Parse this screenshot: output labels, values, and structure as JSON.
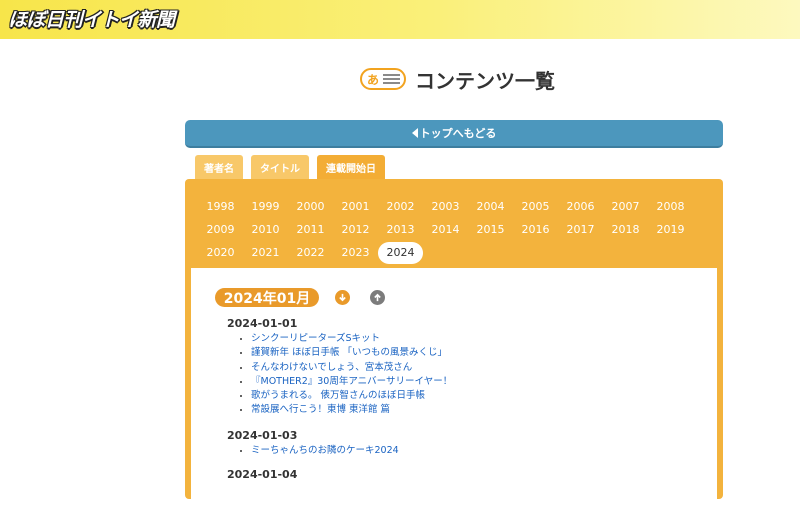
{
  "site": {
    "logo": "ほぼ日刊イトイ新聞"
  },
  "page": {
    "title_icon_letter": "あ",
    "title": "コンテンツ一覧"
  },
  "nav": {
    "back_label": "トップへもどる"
  },
  "tabs": [
    {
      "label": "著者名",
      "active": false
    },
    {
      "label": "タイトル",
      "active": false
    },
    {
      "label": "連載開始日",
      "active": true
    }
  ],
  "years": [
    [
      "1998",
      "1999",
      "2000",
      "2001",
      "2002",
      "2003",
      "2004",
      "2005",
      "2006",
      "2007",
      "2008"
    ],
    [
      "2009",
      "2010",
      "2011",
      "2012",
      "2013",
      "2014",
      "2015",
      "2016",
      "2017",
      "2018",
      "2019"
    ],
    [
      "2020",
      "2021",
      "2022",
      "2023",
      "2024"
    ]
  ],
  "selected_year": "2024",
  "month": {
    "label": "2024年01月",
    "next_icon": "arrow-down-circle-icon",
    "prev_icon": "arrow-up-circle-icon"
  },
  "entries": [
    {
      "date": "2024-01-01",
      "items": [
        "シンクーリピーターズSキット",
        "謹賀新年 ほぼ日手帳 「いつもの風景みくじ」",
        "そんなわけないでしょう、宮本茂さん",
        "『MOTHER2』30周年アニバーサリーイヤー！",
        "歌がうまれる。 俵万智さんのほぼ日手帳",
        "常設展へ行こう！東博 東洋館 篇"
      ]
    },
    {
      "date": "2024-01-03",
      "items": [
        "ミーちゃんちのお隣のケーキ2024"
      ]
    },
    {
      "date": "2024-01-04",
      "items": []
    }
  ],
  "colors": {
    "header_yellow": "#f7e54a",
    "orange": "#f3b33d",
    "blue_button": "#4c97bd",
    "link": "#1a63c2"
  }
}
